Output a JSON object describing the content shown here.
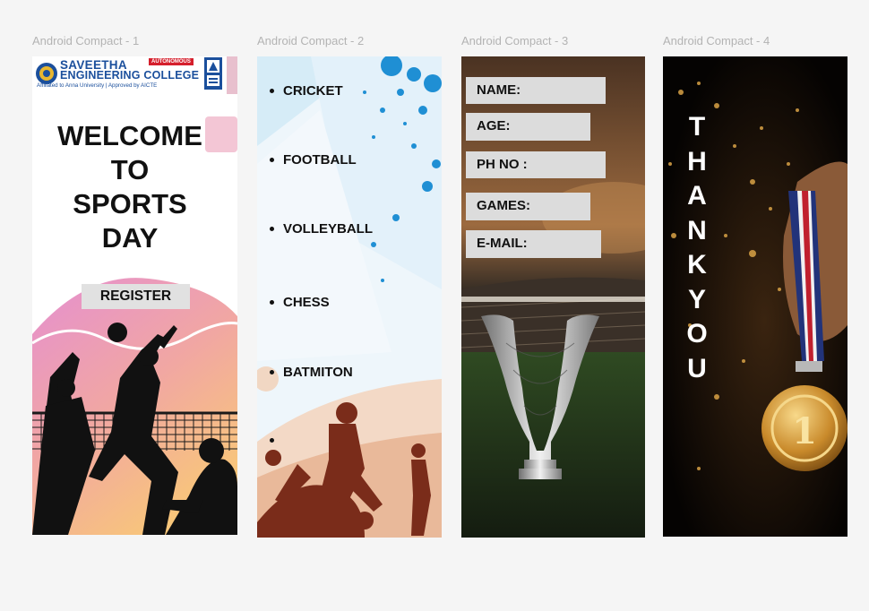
{
  "frames": [
    {
      "label": "Android Compact - 1"
    },
    {
      "label": "Android Compact - 2"
    },
    {
      "label": "Android Compact - 3"
    },
    {
      "label": "Android Compact - 4"
    }
  ],
  "screen1": {
    "college_name_line1": "SAVEETHA",
    "college_name_line2": "ENGINEERING COLLEGE",
    "college_tagline": "Affiliated to Anna University | Approved by AICTE",
    "autonomous_badge": "AUTONOMOUS",
    "welcome_lines": [
      "WELCOME",
      "TO",
      "SPORTS",
      "DAY"
    ],
    "register_label": "REGISTER"
  },
  "screen2": {
    "games": [
      "CRICKET",
      "FOOTBALL",
      "VOLLEYBALL",
      "CHESS",
      "BATMITON",
      ""
    ]
  },
  "screen3": {
    "fields": [
      "NAME:",
      "AGE:",
      "PH NO :",
      "GAMES:",
      "E-MAIL:"
    ]
  },
  "screen4": {
    "letters": [
      "T",
      "H",
      "A",
      "N",
      "K",
      "Y",
      "O",
      "U"
    ]
  },
  "colors": {
    "canvas_bg": "#f5f5f5",
    "frame_label": "#b3b3b3",
    "field_bg": "#dcdcdc",
    "brand_blue": "#1b4f9c",
    "gold": "#c98a2b"
  }
}
